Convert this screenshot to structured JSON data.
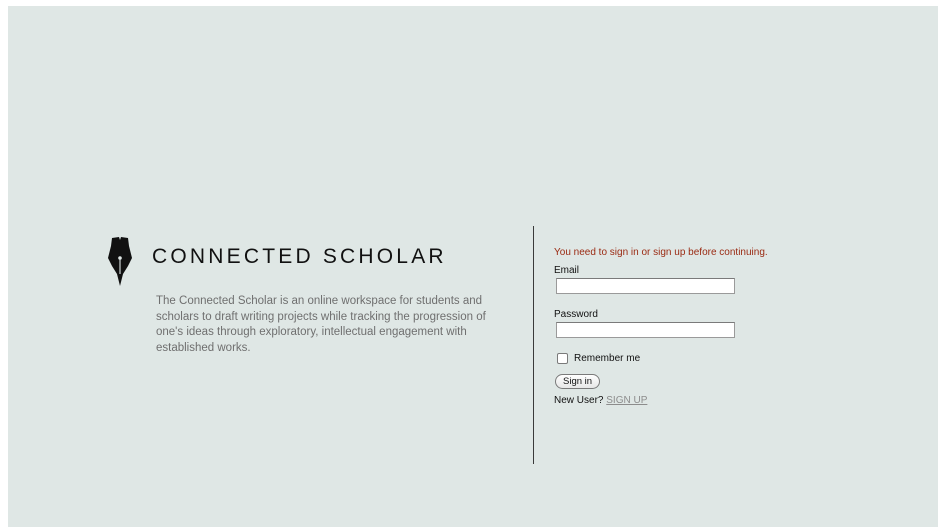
{
  "brand": {
    "title": "CONNECTED SCHOLAR",
    "description": "The Connected Scholar is an online workspace for students and scholars to draft writing projects while tracking the progression of one's ideas through exploratory, intellectual engagement with established works.",
    "icon": "fountain-pen-nib-icon"
  },
  "form": {
    "alert": "You need to sign in or sign up before continuing.",
    "email_label": "Email",
    "email_value": "",
    "password_label": "Password",
    "password_value": "",
    "remember_label": "Remember me",
    "remember_checked": false,
    "signin_label": "Sign in",
    "new_user_text": "New User?",
    "signup_label": "SIGN UP"
  },
  "colors": {
    "background": "#dfe7e5",
    "alert": "#9a2a12",
    "link": "#8c8c8c",
    "text": "#111111"
  }
}
